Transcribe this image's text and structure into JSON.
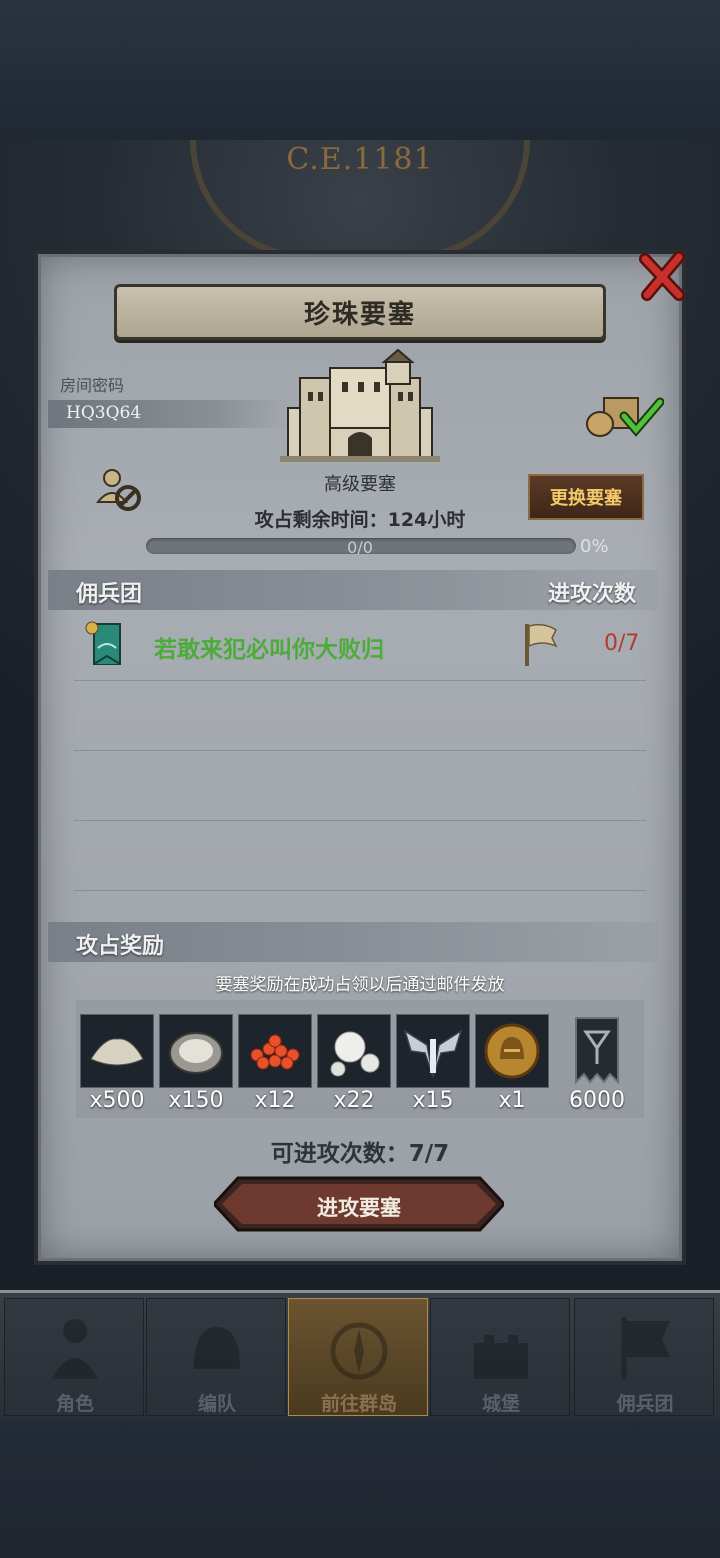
{
  "era": "C.E.1181",
  "dialog": {
    "title": "珍珠要塞",
    "close_icon": "close-icon",
    "room": {
      "label": "房间密码",
      "code": "HQ3Q64"
    },
    "fortress_type": "高级要塞",
    "time_left": "攻占剩余时间：124小时",
    "change_button": "更换要塞",
    "progress": {
      "count": "0/0",
      "percent": "0%",
      "fill_fraction": 0
    },
    "colors": {
      "accent_gold": "#f3c86a",
      "guild_green": "#4dab3c",
      "count_red": "#b23b30"
    }
  },
  "mercenary": {
    "header": "佣兵团",
    "attacks_header": "进攻次数",
    "rows": [
      {
        "name": "若敢来犯必叫你大败归",
        "attacks": "0/7"
      }
    ]
  },
  "rewards": {
    "header": "攻占奖励",
    "note": "要塞奖励在成功占领以后通过邮件发放",
    "items": [
      {
        "icon": "flour-icon",
        "qty": "x500"
      },
      {
        "icon": "oyster-icon",
        "qty": "x150"
      },
      {
        "icon": "roe-icon",
        "qty": "x12"
      },
      {
        "icon": "pearl-icon",
        "qty": "x22"
      },
      {
        "icon": "wing-emblem-icon",
        "qty": "x15"
      },
      {
        "icon": "helmet-coin-icon",
        "qty": "x1"
      },
      {
        "icon": "guild-banner-icon",
        "qty": "6000"
      }
    ]
  },
  "attacks_left": "可进攻次数：7/7",
  "attack_button": "进攻要塞",
  "nav": [
    {
      "label": "角色",
      "icon": "knight-icon",
      "active": false
    },
    {
      "label": "编队",
      "icon": "helmet-icon",
      "active": false
    },
    {
      "label": "前往群岛",
      "icon": "compass-icon",
      "active": true
    },
    {
      "label": "城堡",
      "icon": "castle-icon",
      "active": false
    },
    {
      "label": "佣兵团",
      "icon": "banner-icon",
      "active": false
    }
  ]
}
